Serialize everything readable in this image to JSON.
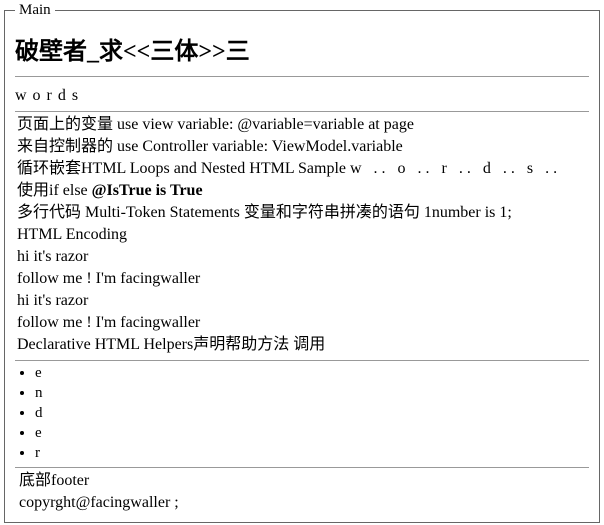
{
  "fieldset": {
    "legend": "Main",
    "heading": "破壁者_求<<三体>>三",
    "section_title": "words",
    "body_lines": [
      {
        "prefix": "页面上的变量 use view variable: @variable=variable at page",
        "spaced": ""
      },
      {
        "prefix": "来自控制器的 use Controller variable: ViewModel.variable",
        "spaced": ""
      },
      {
        "prefix": "循环嵌套HTML Loops and Nested HTML Sample ",
        "spaced": "w .. o .. r .. d .. s .."
      },
      {
        "prefix": "使用if else ",
        "bold": "@IsTrue is True"
      },
      {
        "prefix": "多行代码 Multi-Token Statements 变量和字符串拼凑的语句 1number is 1;",
        "spaced": ""
      },
      {
        "prefix": "HTML Encoding",
        "spaced": ""
      },
      {
        "prefix": "hi it's razor",
        "spaced": ""
      },
      {
        "prefix": "follow me ! I'm facingwaller",
        "spaced": ""
      },
      {
        "prefix": "hi it's razor",
        "spaced": ""
      },
      {
        "prefix": "follow me ! I'm facingwaller",
        "spaced": ""
      },
      {
        "prefix": "Declarative HTML Helpers声明帮助方法 调用",
        "spaced": ""
      }
    ],
    "letters": [
      "e",
      "n",
      "d",
      "e",
      "r"
    ],
    "footer": {
      "line1": "底部footer",
      "line2": "copyrght@facingwaller ;"
    }
  }
}
